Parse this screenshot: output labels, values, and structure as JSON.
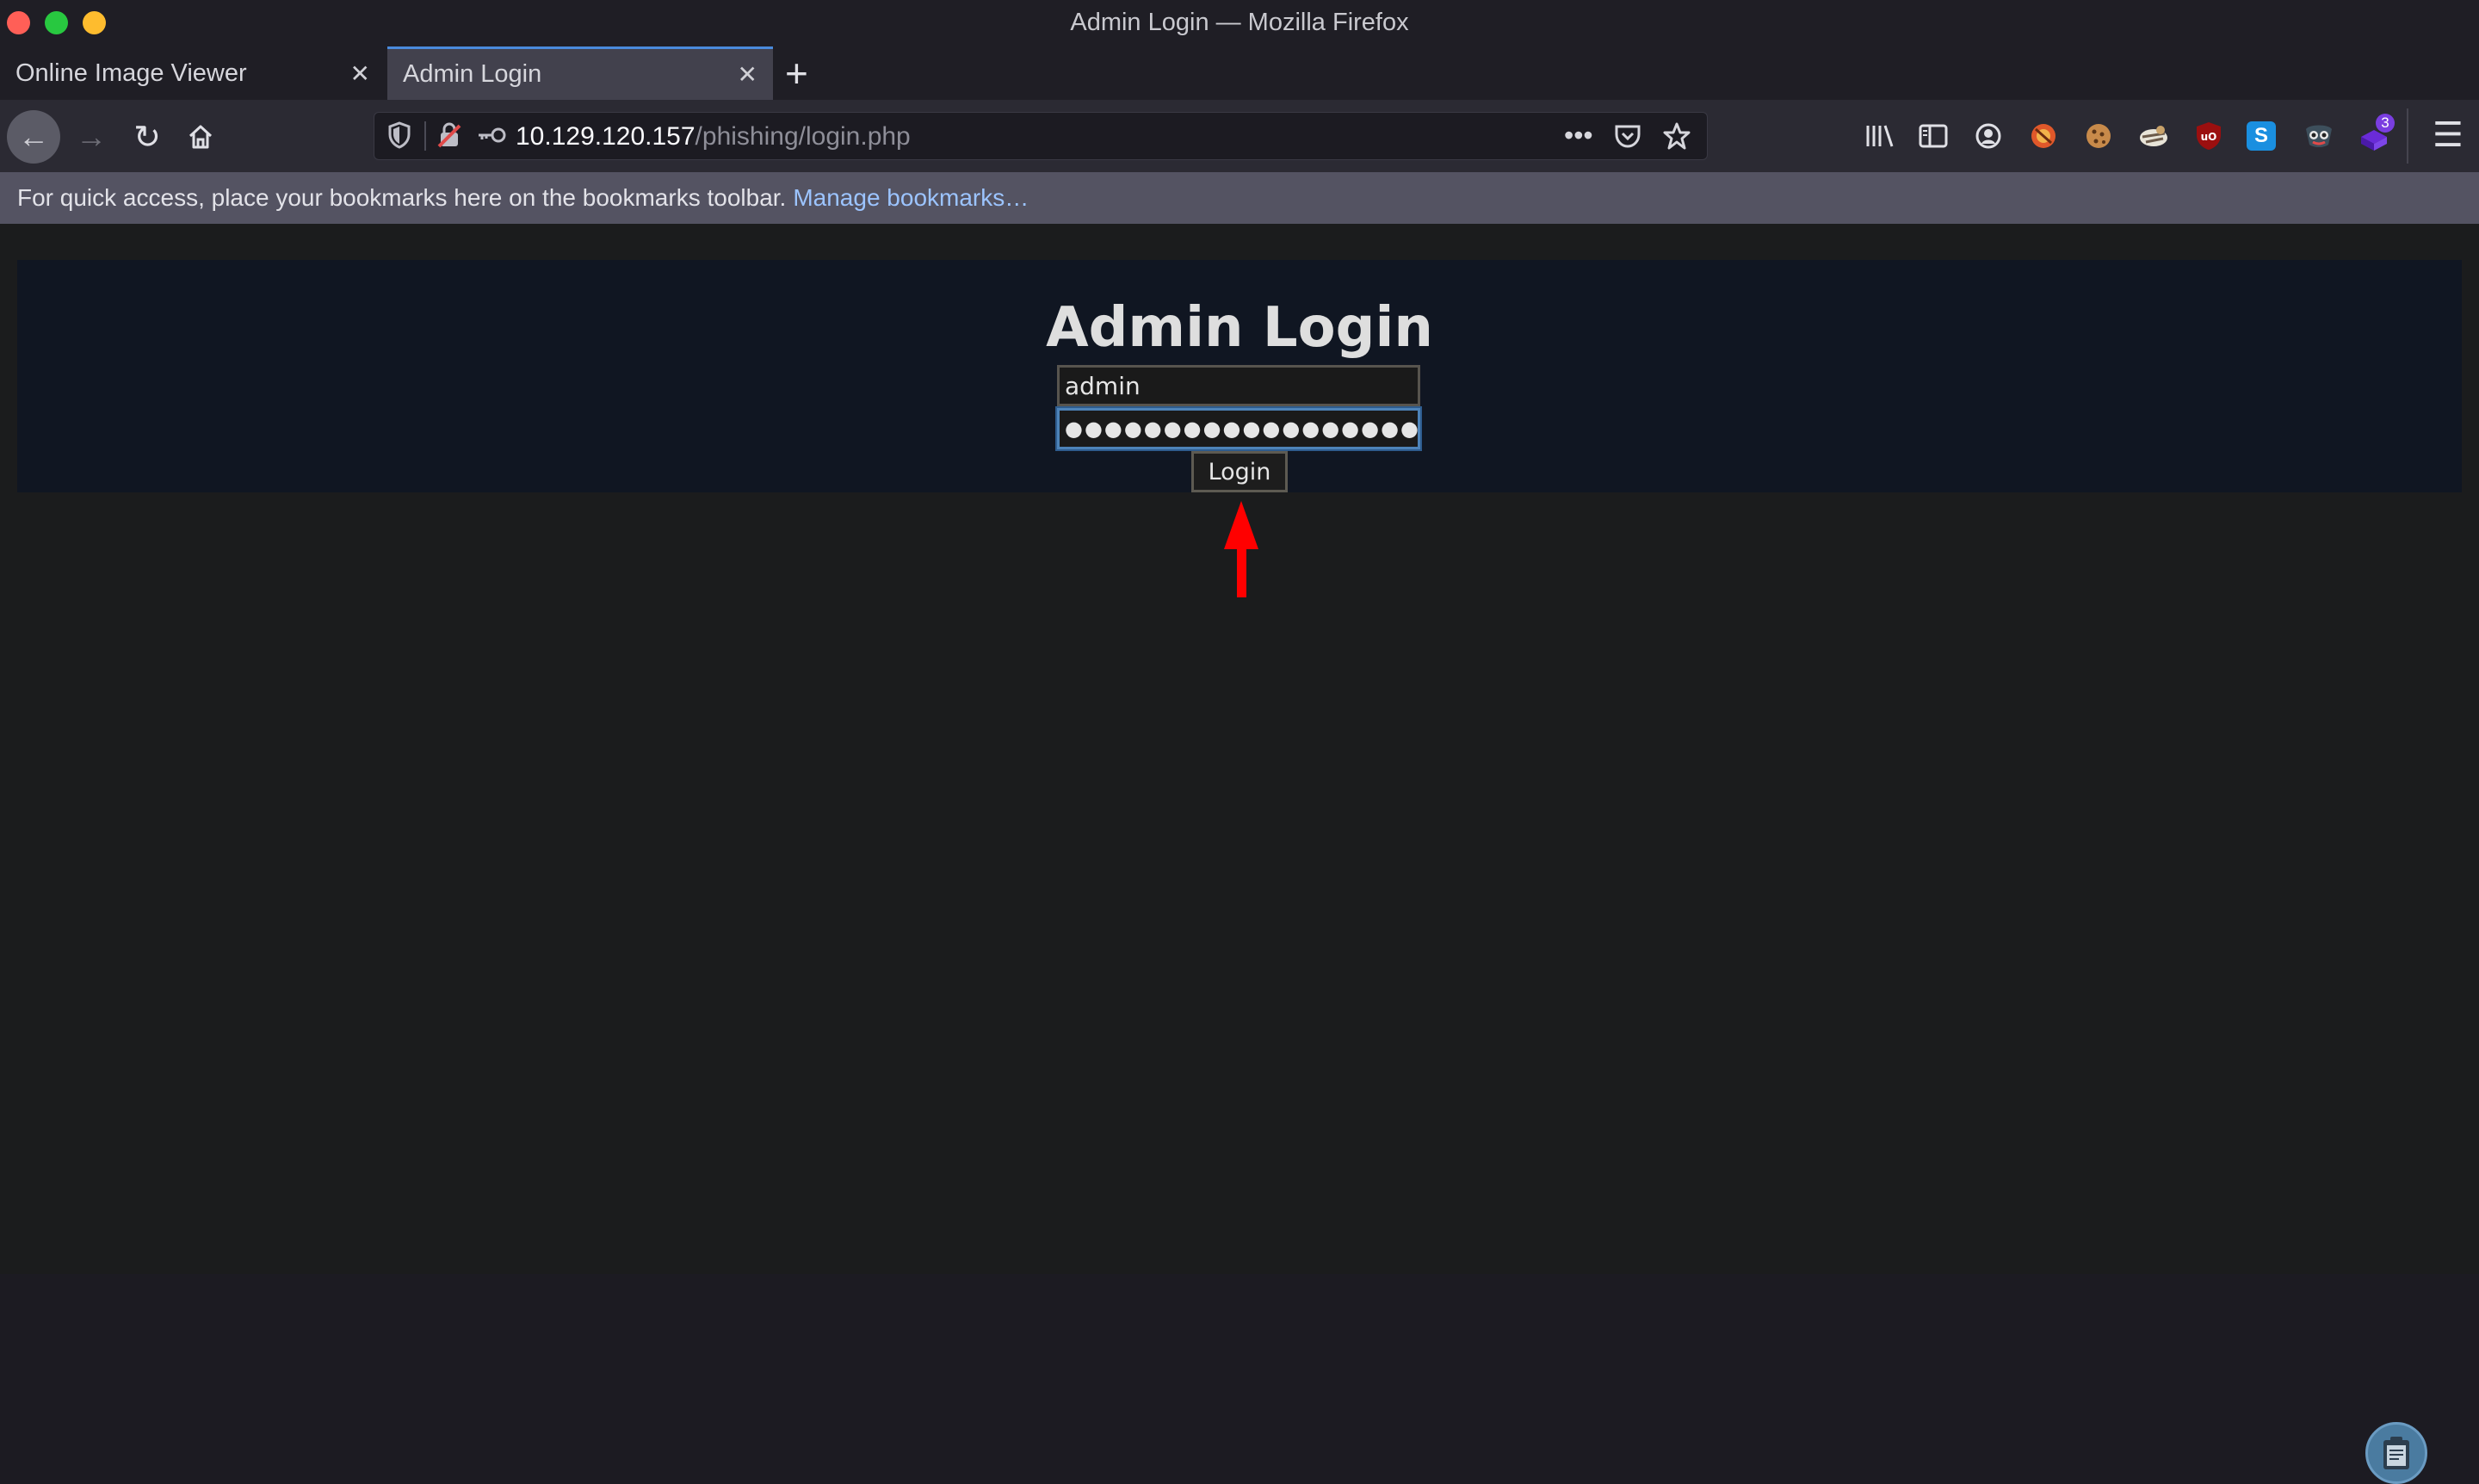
{
  "window": {
    "title": "Admin Login — Mozilla Firefox"
  },
  "tabs": [
    {
      "label": "Online Image Viewer",
      "close": "✕",
      "active": false
    },
    {
      "label": "Admin Login",
      "close": "✕",
      "active": true
    }
  ],
  "new_tab": "+",
  "nav": {
    "back_icon": "arrow-left-icon",
    "forward_icon": "arrow-right-icon",
    "reload_icon": "reload-icon",
    "home_icon": "home-icon"
  },
  "url": {
    "host": "10.129.120.157",
    "path": "/phishing/login.php",
    "more": "•••"
  },
  "toolbar_extensions": [
    {
      "name": "library-icon",
      "glyph": "|||\\"
    },
    {
      "name": "sidebar-icon",
      "glyph": "▤"
    },
    {
      "name": "account-icon",
      "glyph": "◉"
    },
    {
      "name": "extension-wappalyzer-icon",
      "glyph": "◆"
    },
    {
      "name": "extension-cookie-icon",
      "glyph": "●"
    },
    {
      "name": "extension-hacktools-icon",
      "glyph": "◈"
    },
    {
      "name": "extension-ublock-icon",
      "glyph": "uo"
    },
    {
      "name": "extension-s-icon",
      "glyph": "S"
    },
    {
      "name": "extension-foxyproxy-icon",
      "glyph": "◐"
    },
    {
      "name": "extension-stack-icon",
      "glyph": "◆",
      "badge": "3"
    }
  ],
  "menu": "☰",
  "bookmarks": {
    "message": "For quick access, place your bookmarks here on the bookmarks toolbar.",
    "manage_link": "Manage bookmarks…"
  },
  "page": {
    "title": "Admin Login",
    "username_value": "admin",
    "password_mask": "●●●●●●●●●●●●●●●●●●",
    "login_button": "Login"
  },
  "colors": {
    "accent": "#4a8bdc",
    "annotation_arrow": "#ff0000",
    "panel_bg": "#101622"
  }
}
